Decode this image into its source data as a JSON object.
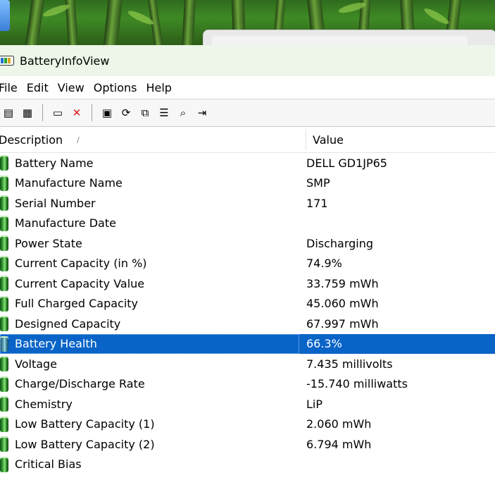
{
  "window": {
    "title": "BatteryInfoView"
  },
  "menu": [
    "File",
    "Edit",
    "View",
    "Options",
    "Help"
  ],
  "toolbar": [
    {
      "name": "properties-icon",
      "glyph": "▤"
    },
    {
      "name": "html-report-icon",
      "glyph": "▦"
    },
    {
      "sep": true
    },
    {
      "name": "options-icon",
      "glyph": "▭"
    },
    {
      "name": "delete-icon",
      "glyph": "✕",
      "color": "#d81a1a"
    },
    {
      "sep": true
    },
    {
      "name": "save-icon",
      "glyph": "▣"
    },
    {
      "name": "refresh-icon",
      "glyph": "⟳"
    },
    {
      "name": "copy-icon",
      "glyph": "⧉"
    },
    {
      "name": "properties-sheet-icon",
      "glyph": "☰"
    },
    {
      "name": "find-icon",
      "glyph": "⌕"
    },
    {
      "name": "exit-icon",
      "glyph": "⇥"
    }
  ],
  "columns": {
    "description": "Description",
    "value": "Value"
  },
  "rows": [
    {
      "description": "Battery Name",
      "value": "DELL GD1JP65"
    },
    {
      "description": "Manufacture Name",
      "value": "SMP"
    },
    {
      "description": "Serial Number",
      "value": "171"
    },
    {
      "description": "Manufacture Date",
      "value": ""
    },
    {
      "description": "Power State",
      "value": "Discharging"
    },
    {
      "description": "Current Capacity (in %)",
      "value": "74.9%"
    },
    {
      "description": "Current Capacity Value",
      "value": "33.759 mWh"
    },
    {
      "description": "Full Charged Capacity",
      "value": "45.060 mWh"
    },
    {
      "description": "Designed Capacity",
      "value": "67.997 mWh"
    },
    {
      "description": "Battery Health",
      "value": "66.3%",
      "selected": true
    },
    {
      "description": "Voltage",
      "value": "7.435 millivolts"
    },
    {
      "description": "Charge/Discharge Rate",
      "value": "-15.740 milliwatts"
    },
    {
      "description": "Chemistry",
      "value": "LiP"
    },
    {
      "description": "Low Battery Capacity (1)",
      "value": "2.060 mWh"
    },
    {
      "description": "Low Battery Capacity (2)",
      "value": "6.794 mWh"
    },
    {
      "description": "Critical Bias",
      "value": ""
    }
  ],
  "colors": {
    "selection": "#0a64c8",
    "titlebar": "#edf6e8"
  }
}
